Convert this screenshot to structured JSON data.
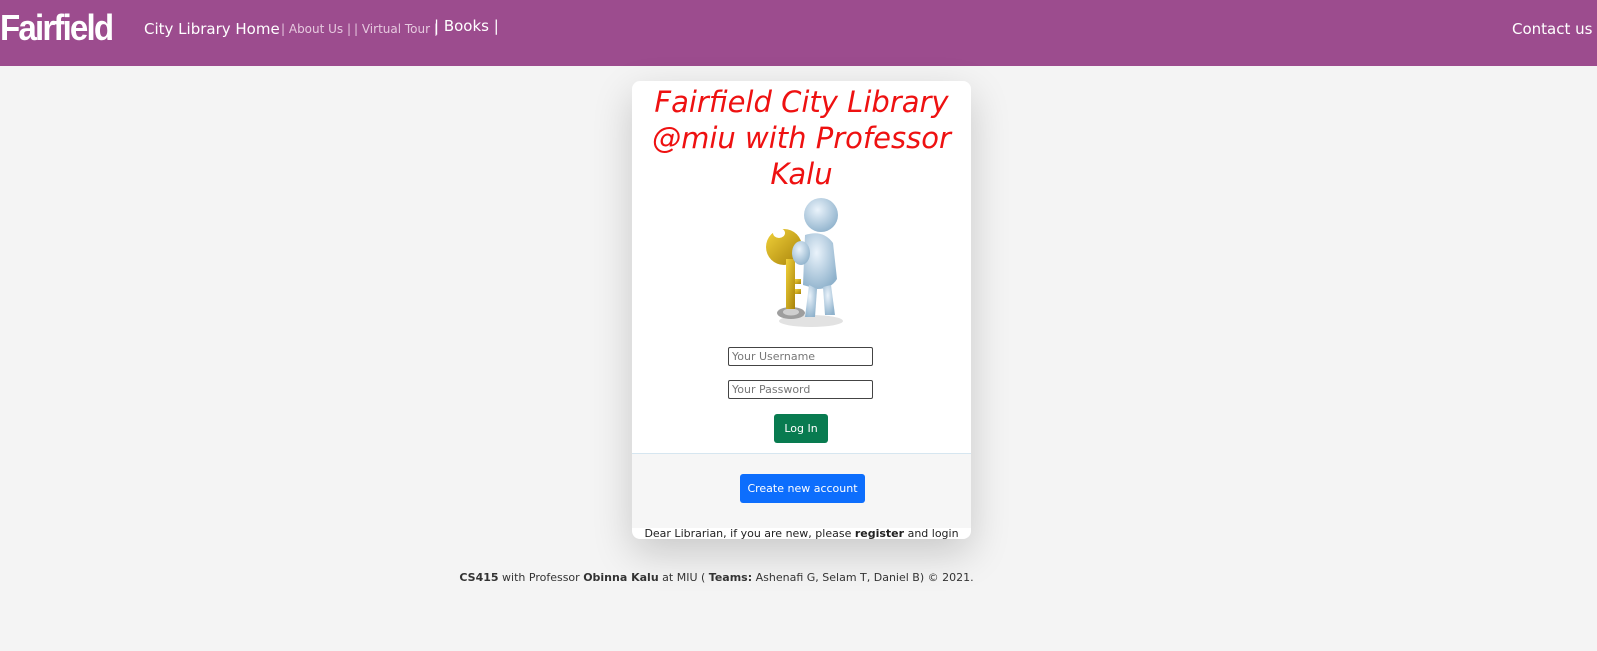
{
  "navbar": {
    "brand": "Fairfield",
    "home": "City Library Home",
    "about": "| About Us |",
    "tour": "| Virtual Tour |",
    "books": "| Books |",
    "contact": "Contact us"
  },
  "colors": {
    "navbar_bg": "#9c4c8e",
    "title_red": "#ee1111",
    "login_green": "#087b50",
    "create_blue": "#0d6efd"
  },
  "card": {
    "title_line1": "Fairfield City Library",
    "title_line2": "@miu with Professor",
    "title_line3": "Kalu",
    "illustration": "person-holding-key-icon",
    "username_placeholder": "Your Username",
    "password_placeholder": "Your Password",
    "login_label": "Log In",
    "create_label": "Create new account",
    "note_prefix": "Dear Librarian, if you are new, please ",
    "note_register": "register",
    "note_suffix": " and login"
  },
  "footer": {
    "course": "CS415",
    "with": " with Professor ",
    "professor": "Obinna Kalu",
    "at": " at MIU ( ",
    "teams_label": "Teams:",
    "teams": " Ashenafi G, Selam T, Daniel B) © 2021."
  }
}
